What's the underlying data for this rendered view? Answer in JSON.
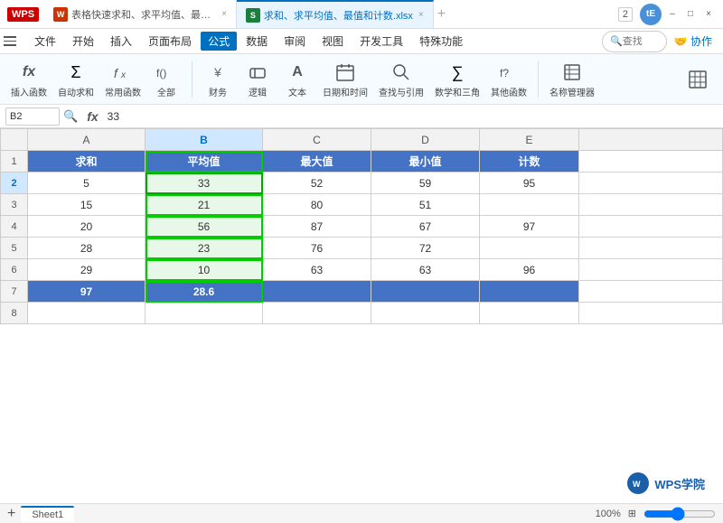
{
  "titlebar": {
    "wps_label": "WPS",
    "tabs": [
      {
        "id": "tab1",
        "icon_text": "W",
        "icon_color": "#cc3300",
        "label": "表格快速求和、求平均值、最值和计数 ...",
        "active": false,
        "closable": true
      },
      {
        "id": "tab2",
        "icon_text": "S",
        "icon_color": "#1a7e3c",
        "label": "求和、求平均值、最值和计数.xlsx",
        "active": true,
        "closable": true
      }
    ],
    "window_num": "2",
    "user_initials": "tE"
  },
  "menubar": {
    "items": [
      "文件",
      "开始",
      "插入",
      "页面布局",
      "公式",
      "数据",
      "审阅",
      "视图",
      "开发工具",
      "特殊功能"
    ],
    "active_index": 4,
    "search_placeholder": "查找"
  },
  "toolbar": {
    "groups": [
      {
        "id": "insert-fn",
        "label": "插入函数",
        "icon": "fx"
      },
      {
        "id": "auto-sum",
        "label": "自动求和",
        "icon": "Σ"
      },
      {
        "id": "common-fn",
        "label": "常用函数",
        "icon": "f"
      },
      {
        "id": "all-fn",
        "label": "全部",
        "icon": "f()"
      },
      {
        "id": "finance",
        "label": "财务",
        "icon": "¥"
      },
      {
        "id": "logic",
        "label": "逻辑",
        "icon": "⊕"
      },
      {
        "id": "text",
        "label": "文本",
        "icon": "A"
      },
      {
        "id": "datetime",
        "label": "日期和时间",
        "icon": "📅"
      },
      {
        "id": "lookup",
        "label": "查找与引用",
        "icon": "🔍"
      },
      {
        "id": "math",
        "label": "数学和三角",
        "icon": "∑"
      },
      {
        "id": "other",
        "label": "其他函数",
        "icon": "f?"
      },
      {
        "id": "name-mgr",
        "label": "名称管理器",
        "icon": "📋"
      }
    ],
    "right_group": {
      "label": "📊",
      "icon": "table-icon"
    }
  },
  "formula_bar": {
    "cell_ref": "B2",
    "formula_value": "33",
    "fx_label": "fx",
    "zoom_icon": "🔍"
  },
  "spreadsheet": {
    "col_headers": [
      "",
      "A",
      "B",
      "C",
      "D",
      "E"
    ],
    "active_col": "B",
    "rows": [
      {
        "row_num": "1",
        "is_header": true,
        "cells": [
          {
            "col": "A",
            "value": "求和",
            "type": "header"
          },
          {
            "col": "B",
            "value": "平均值",
            "type": "header"
          },
          {
            "col": "C",
            "value": "最大值",
            "type": "header"
          },
          {
            "col": "D",
            "value": "最小值",
            "type": "header"
          },
          {
            "col": "E",
            "value": "计数",
            "type": "header"
          }
        ]
      },
      {
        "row_num": "2",
        "cells": [
          {
            "col": "A",
            "value": "5",
            "type": "data"
          },
          {
            "col": "B",
            "value": "33",
            "type": "selected"
          },
          {
            "col": "C",
            "value": "52",
            "type": "data"
          },
          {
            "col": "D",
            "value": "59",
            "type": "data"
          },
          {
            "col": "E",
            "value": "95",
            "type": "data"
          }
        ]
      },
      {
        "row_num": "3",
        "cells": [
          {
            "col": "A",
            "value": "15",
            "type": "data"
          },
          {
            "col": "B",
            "value": "21",
            "type": "selected-col"
          },
          {
            "col": "C",
            "value": "80",
            "type": "data"
          },
          {
            "col": "D",
            "value": "51",
            "type": "data"
          },
          {
            "col": "E",
            "value": "",
            "type": "empty"
          }
        ]
      },
      {
        "row_num": "4",
        "cells": [
          {
            "col": "A",
            "value": "20",
            "type": "data"
          },
          {
            "col": "B",
            "value": "56",
            "type": "selected-col"
          },
          {
            "col": "C",
            "value": "87",
            "type": "data"
          },
          {
            "col": "D",
            "value": "67",
            "type": "data"
          },
          {
            "col": "E",
            "value": "97",
            "type": "data"
          }
        ]
      },
      {
        "row_num": "5",
        "cells": [
          {
            "col": "A",
            "value": "28",
            "type": "data"
          },
          {
            "col": "B",
            "value": "23",
            "type": "selected-col"
          },
          {
            "col": "C",
            "value": "76",
            "type": "data"
          },
          {
            "col": "D",
            "value": "72",
            "type": "data"
          },
          {
            "col": "E",
            "value": "",
            "type": "empty"
          }
        ]
      },
      {
        "row_num": "6",
        "cells": [
          {
            "col": "A",
            "value": "29",
            "type": "data"
          },
          {
            "col": "B",
            "value": "10",
            "type": "selected-col"
          },
          {
            "col": "C",
            "value": "63",
            "type": "data"
          },
          {
            "col": "D",
            "value": "63",
            "type": "data"
          },
          {
            "col": "E",
            "value": "96",
            "type": "data"
          }
        ]
      },
      {
        "row_num": "7",
        "is_total": true,
        "cells": [
          {
            "col": "A",
            "value": "97",
            "type": "total"
          },
          {
            "col": "B",
            "value": "28.6",
            "type": "total-selected"
          },
          {
            "col": "C",
            "value": "",
            "type": "total-empty"
          },
          {
            "col": "D",
            "value": "",
            "type": "total-empty"
          },
          {
            "col": "E",
            "value": "",
            "type": "total-empty"
          }
        ]
      },
      {
        "row_num": "8",
        "cells": [
          {
            "col": "A",
            "value": "",
            "type": "empty"
          },
          {
            "col": "B",
            "value": "",
            "type": "empty"
          },
          {
            "col": "C",
            "value": "",
            "type": "empty"
          },
          {
            "col": "D",
            "value": "",
            "type": "empty"
          },
          {
            "col": "E",
            "value": "",
            "type": "empty"
          }
        ]
      }
    ]
  },
  "bottombar": {
    "sheet_tabs": [
      "Sheet1"
    ],
    "active_tab": "Sheet1"
  },
  "branding": {
    "logo_text": "W",
    "label": "WPS学院"
  }
}
